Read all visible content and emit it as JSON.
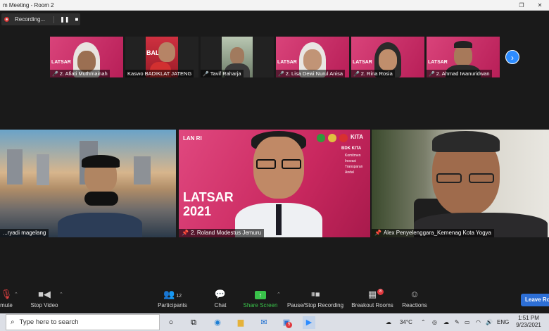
{
  "window": {
    "title": "m Meeting - Room 2",
    "restore_glyph": "❐",
    "close_glyph": "✕"
  },
  "recording": {
    "label": "Recording...",
    "pause_glyph": "❚❚",
    "stop_glyph": "■"
  },
  "thumbnails": [
    {
      "name": "2. Afiati Muthmainah",
      "banner": "LATSAR"
    },
    {
      "name": "Kaswo BADIKLAT JATENG",
      "banner": "BAL JAT"
    },
    {
      "name": "Tavif Raharja",
      "banner": ""
    },
    {
      "name": "2. Lisa Dewi Nurul Anisa",
      "banner": "LATSAR"
    },
    {
      "name": "2. Rina Rosia",
      "banner": "LATSAR"
    },
    {
      "name": "2. Ahmad Iwanuridwan",
      "banner": "LATSAR"
    }
  ],
  "main_tiles": [
    {
      "name": "...ryadi magelang"
    },
    {
      "name": "2. Roland Modestus Jemuru",
      "brand": "LAN RI",
      "banner_year": "LATSAR 2021",
      "bdk_title": "BDK KITA",
      "bdk_lines": [
        "Komitmen",
        "Inovasi",
        "Transparan",
        "Andal"
      ]
    },
    {
      "name": "Alex Penyelenggara_Kemenag Kota Yogya"
    }
  ],
  "toolbar": {
    "unmute": "mute",
    "stop_video": "Stop Video",
    "participants": "Participants",
    "participants_count": "12",
    "chat": "Chat",
    "share_screen": "Share Screen",
    "pause_recording": "Pause/Stop Recording",
    "breakout_rooms": "Breakout Rooms",
    "breakout_badge": "8",
    "reactions": "Reactions",
    "leave": "Leave Ro"
  },
  "taskbar": {
    "search_placeholder": "Type here to search",
    "temperature": "34°C",
    "language": "ENG",
    "time": "1:51 PM",
    "date": "9/23/2021",
    "notif_badge": "5"
  },
  "colors": {
    "zoom_blue": "#2d8cff",
    "latsar_pink": "#c9285f",
    "active_border": "#c9e24a",
    "share_green": "#39c24a"
  }
}
